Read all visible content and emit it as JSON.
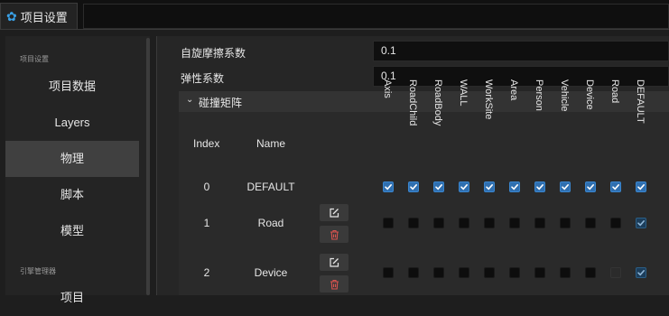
{
  "tab": {
    "title": "项目设置",
    "icon": "gear-icon"
  },
  "sidebar": {
    "section1": "项目设置",
    "items": [
      {
        "label": "项目数据"
      },
      {
        "label": "Layers"
      },
      {
        "label": "物理",
        "active": true
      },
      {
        "label": "脚本"
      },
      {
        "label": "模型"
      }
    ],
    "section2": "引擎管理器",
    "partial_item": "项目"
  },
  "physics": {
    "friction_label": "自旋摩擦系数",
    "friction_value": "0.1",
    "restitution_label": "弹性系数",
    "restitution_value": "0.1",
    "matrix_title": "碰撞矩阵"
  },
  "matrix": {
    "index_header": "Index",
    "name_header": "Name",
    "layers": [
      "Axis",
      "RoadChild",
      "RoadBody",
      "WALL",
      "WorkSite",
      "Area",
      "Person",
      "Vehicle",
      "Device",
      "Road",
      "DEFAULT"
    ],
    "rows": [
      {
        "index": "0",
        "name": "DEFAULT",
        "editable": false,
        "states": [
          "on",
          "on",
          "on",
          "on",
          "on",
          "on",
          "on",
          "on",
          "on",
          "on",
          "on"
        ]
      },
      {
        "index": "1",
        "name": "Road",
        "editable": true,
        "states": [
          "off",
          "off",
          "off",
          "off",
          "off",
          "off",
          "off",
          "off",
          "off",
          "off",
          "on-dim"
        ]
      },
      {
        "index": "2",
        "name": "Device",
        "editable": true,
        "states": [
          "off",
          "off",
          "off",
          "off",
          "off",
          "off",
          "off",
          "off",
          "off",
          "dis",
          "on-dim"
        ]
      }
    ]
  },
  "colors": {
    "accent": "#39a0e6",
    "checkbox_on": "#2f6fb0",
    "delete_red": "#d9534f"
  }
}
